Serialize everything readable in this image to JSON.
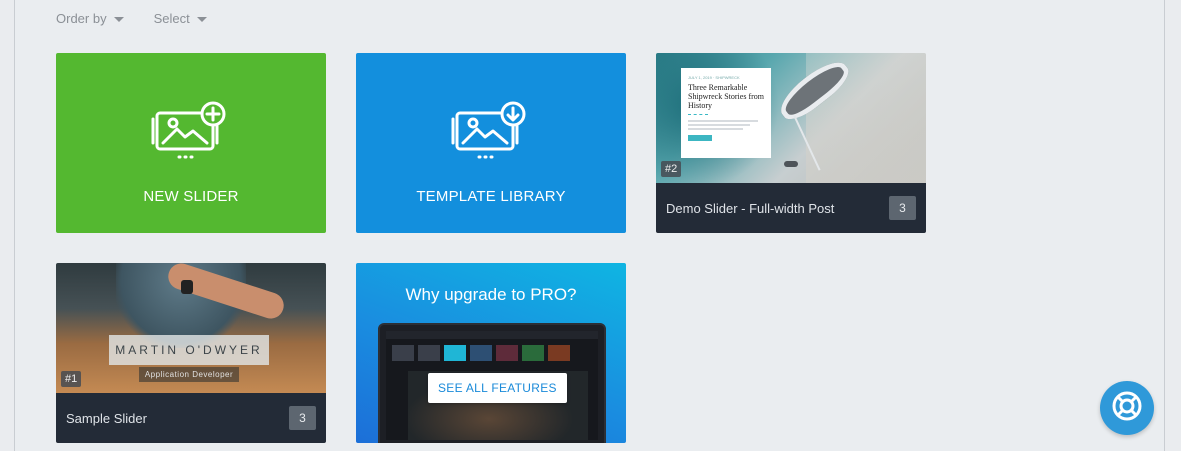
{
  "filters": {
    "order_by": "Order by",
    "select": "Select"
  },
  "actions": {
    "new_slider": "NEW SLIDER",
    "template_library": "TEMPLATE LIBRARY"
  },
  "sliders": [
    {
      "title": "Demo Slider - Full-width Post",
      "id_badge": "#2",
      "count": "3",
      "preview": {
        "kicker": "JULY 1, 2019 · SHIPWRECK",
        "headline": "Three Remarkable Shipwreck Stories from History"
      }
    },
    {
      "title": "Sample Slider",
      "id_badge": "#1",
      "count": "3",
      "preview": {
        "name": "MARTIN O'DWYER",
        "role": "Application Developer"
      }
    }
  ],
  "upgrade": {
    "heading": "Why upgrade to PRO?",
    "button": "SEE ALL FEATURES"
  },
  "colors": {
    "green": "#54b830",
    "blue": "#138fdd",
    "caption_bg": "#232b37",
    "help": "#2f99d9"
  },
  "icons": {
    "new_slider": "image-add-icon",
    "template_library": "image-download-icon",
    "help": "lifebuoy-icon"
  }
}
